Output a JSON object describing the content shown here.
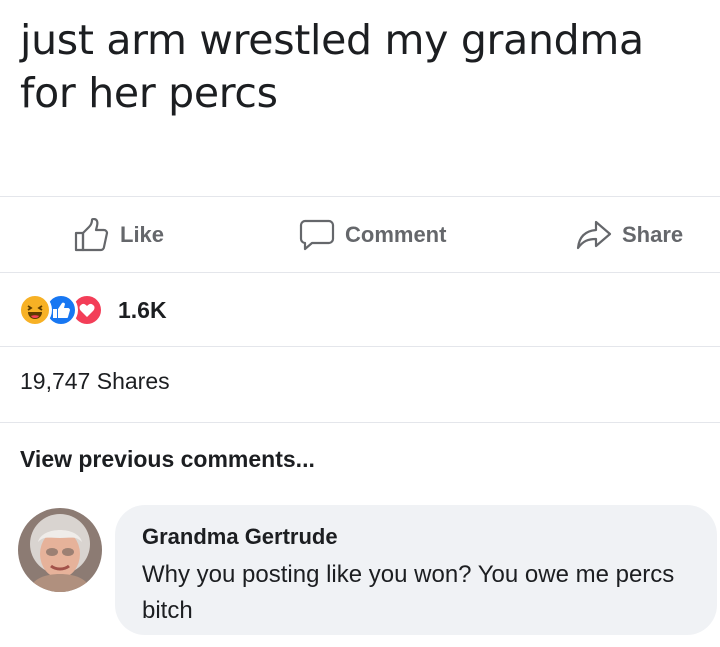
{
  "post": {
    "text": "just arm wrestled my grandma for her percs"
  },
  "actions": {
    "like_label": "Like",
    "comment_label": "Comment",
    "share_label": "Share"
  },
  "reactions": {
    "icons": [
      "haha-icon",
      "like-icon",
      "love-icon"
    ],
    "count": "1.6K"
  },
  "shares_text": "19,747 Shares",
  "view_previous_label": "View previous comments...",
  "comment": {
    "author": "Grandma Gertrude",
    "text": "Why you posting like you won? You owe me percs bitch"
  },
  "colors": {
    "text": "#1c1e21",
    "muted": "#65676b",
    "divider": "#e4e6eb",
    "bubble": "#f0f2f5",
    "like_blue": "#1877f2",
    "love_red": "#f33e58",
    "haha_yellow": "#f7b125"
  }
}
